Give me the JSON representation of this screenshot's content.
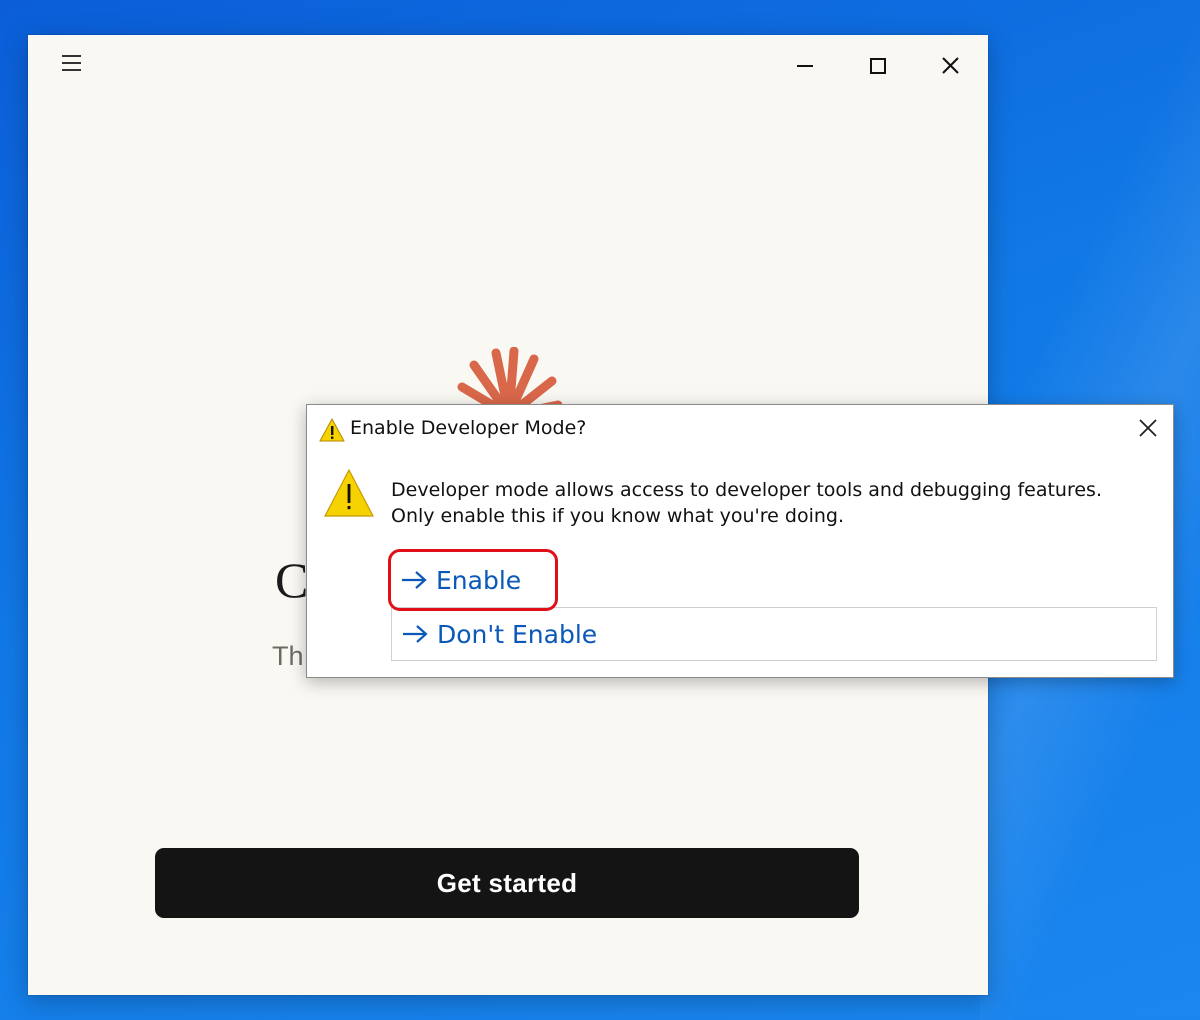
{
  "app": {
    "hero_title": "C",
    "hero_subtitle": "Th",
    "get_started_label": "Get started"
  },
  "dialog": {
    "title": "Enable Developer Mode?",
    "message": "Developer mode allows access to developer tools and debugging features. Only enable this if you know what you're doing.",
    "options": [
      {
        "label": "Enable",
        "highlighted": true
      },
      {
        "label": "Don't Enable",
        "highlighted": false
      }
    ]
  },
  "icons": {
    "menu": "hamburger-icon",
    "minimize": "minimize-icon",
    "maximize": "maximize-icon",
    "close": "close-icon",
    "warning": "warning-icon",
    "command_arrow": "arrow-right-icon",
    "logo": "sunburst-logo"
  },
  "colors": {
    "desktop": "#1179e6",
    "app_background": "#faf8f3",
    "logo": "#d9674a",
    "primary_button": "#141414",
    "link": "#0a58b8",
    "highlight": "#e0101a",
    "warning": "#f6d200"
  }
}
